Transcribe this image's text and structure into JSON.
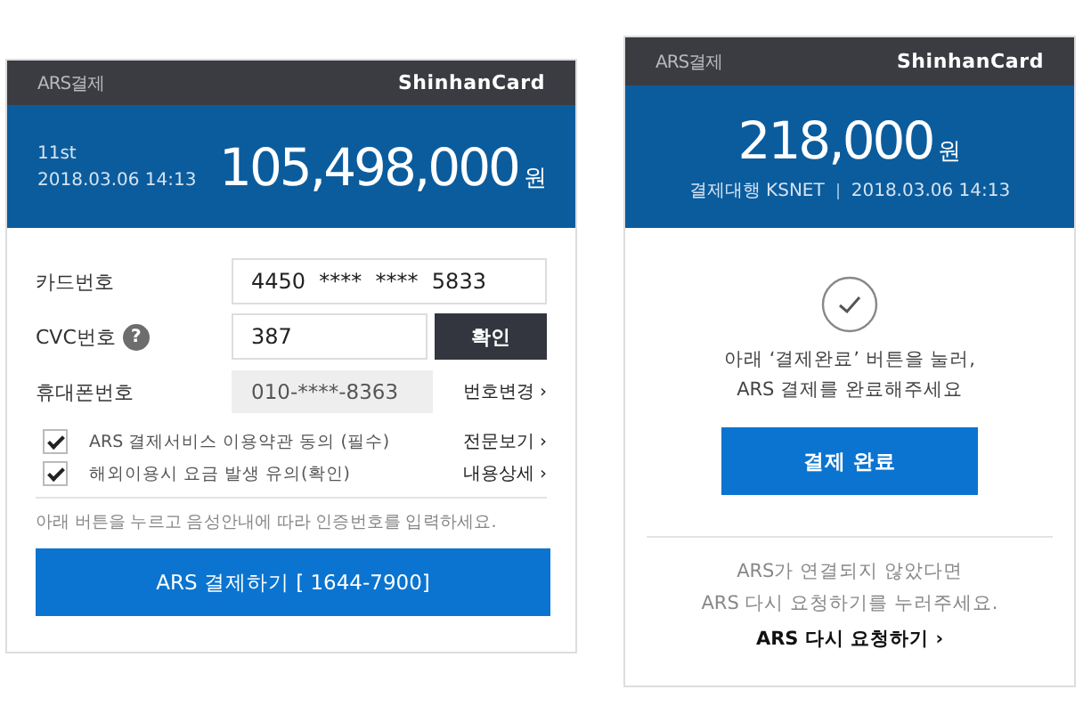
{
  "payment_form": {
    "header": {
      "title": "ARS결제",
      "brand": "ShinhanCard"
    },
    "summary": {
      "merchant": "11st",
      "datetime": "2018.03.06 14:13",
      "amount": "105,498,000",
      "currency": "원"
    },
    "fields": [
      {
        "kind": "input",
        "label": "카드번호",
        "value": "4450  ****  ****  5833"
      },
      {
        "kind": "input_button",
        "label": "CVC번호",
        "help": "?",
        "value": "387",
        "button": "확인"
      },
      {
        "kind": "readonly_link",
        "label": "휴대폰번호",
        "value": "010-****-8363",
        "link": "번호변경 ›"
      }
    ],
    "agreements": [
      {
        "label": "ARS 결제서비스 이용약관 동의 (필수)",
        "checked": true,
        "link": "전문보기 ›"
      },
      {
        "label": "해외이용시 요금 발생 유의(확인)",
        "checked": true,
        "link": "내용상세 ›"
      }
    ],
    "note": "아래 버튼을 누르고 음성안내에 따라 인증번호를 입력하세요.",
    "submit": "ARS 결제하기 [ 1644-7900]"
  },
  "completion": {
    "header": {
      "title": "ARS결제",
      "brand": "ShinhanCard"
    },
    "summary": {
      "amount": "218,000",
      "currency": "원",
      "agent": "결제대행 KSNET",
      "datetime": "2018.03.06  14:13"
    },
    "message": "아래 ‘결제완료’ 버튼을 눌러,\nARS 결제를 완료해주세요",
    "button": "결제 완료",
    "retry_note": "ARS가 연결되지 않았다면\nARS 다시 요청하기를 누러주세요.",
    "retry_link": "ARS 다시 요청하기 ›"
  }
}
